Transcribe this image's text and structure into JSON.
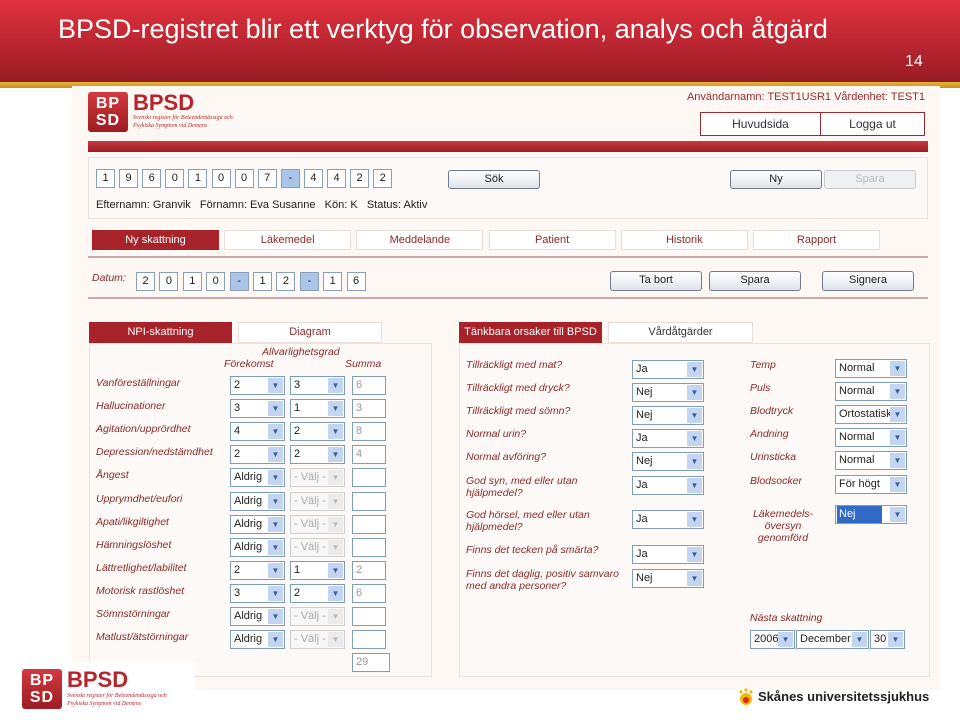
{
  "slide": {
    "title": "BPSD-registret blir ett verktyg för observation, analys och åtgärd",
    "number": "14"
  },
  "app": {
    "logo": {
      "box": "BP SD",
      "word": "BPSD",
      "subtitle1": "Svenskt register för Beteendemässiga och",
      "subtitle2": "Psykiska Symptom vid Demens"
    },
    "user_info": "Användarnamn: TEST1USR1 Vårdenhet: TEST1",
    "nav": {
      "home": "Huvudsida",
      "logout": "Logga ut"
    },
    "search": {
      "digits": [
        "1",
        "9",
        "6",
        "0",
        "1",
        "0",
        "0",
        "7",
        "-",
        "4",
        "4",
        "2",
        "2"
      ],
      "search_label": "Sök",
      "new_label": "Ny",
      "save_label": "Spara"
    },
    "patient": {
      "text": "Efternamn: Granvik   Förnamn: Eva Susanne   Kön: K   Status: Aktiv"
    },
    "tabs": [
      "Ny skattning",
      "Läkemedel",
      "Meddelande",
      "Patient",
      "Historik",
      "Rapport"
    ],
    "date": {
      "label": "Datum:",
      "digits": [
        "2",
        "0",
        "1",
        "0",
        "-",
        "1",
        "2",
        "-",
        "1",
        "6"
      ],
      "delete_label": "Ta bort",
      "save_label": "Spara",
      "sign_label": "Signera"
    },
    "npi": {
      "tabs": [
        "NPI-skattning",
        "Diagram"
      ],
      "headers": {
        "severity": "Allvarlighetsgrad",
        "frequency": "Förekomst",
        "sum": "Summa"
      },
      "rows": [
        {
          "label": "Vanföreställningar",
          "freq": "2",
          "sev": "3",
          "sum": "6"
        },
        {
          "label": "Hallucinationer",
          "freq": "3",
          "sev": "1",
          "sum": "3"
        },
        {
          "label": "Agitation/upprördhet",
          "freq": "4",
          "sev": "2",
          "sum": "8"
        },
        {
          "label": "Depression/nedstämdhet",
          "freq": "2",
          "sev": "2",
          "sum": "4"
        },
        {
          "label": "Ångest",
          "freq": "Aldrig",
          "sev": "- Välj -",
          "sum": ""
        },
        {
          "label": "Upprymdhet/eufori",
          "freq": "Aldrig",
          "sev": "- Välj -",
          "sum": ""
        },
        {
          "label": "Apati/likgiltighet",
          "freq": "Aldrig",
          "sev": "- Välj -",
          "sum": ""
        },
        {
          "label": "Hämningslöshet",
          "freq": "Aldrig",
          "sev": "- Välj -",
          "sum": ""
        },
        {
          "label": "Lättretlighet/labilitet",
          "freq": "2",
          "sev": "1",
          "sum": "2"
        },
        {
          "label": "Motorisk rastlöshet",
          "freq": "3",
          "sev": "2",
          "sum": "6"
        },
        {
          "label": "Sömnstörningar",
          "freq": "Aldrig",
          "sev": "- Välj -",
          "sum": ""
        },
        {
          "label": "Matlust/ätstörningar",
          "freq": "Aldrig",
          "sev": "- Välj -",
          "sum": ""
        }
      ],
      "total": "29"
    },
    "causes": {
      "tabs": [
        "Tänkbara orsaker till BPSD",
        "Vårdåtgärder"
      ],
      "questions": [
        {
          "label": "Tillräckligt med mat?",
          "value": "Ja"
        },
        {
          "label": "Tillräckligt med dryck?",
          "value": "Nej"
        },
        {
          "label": "Tillräckligt med sömn?",
          "value": "Nej"
        },
        {
          "label": "Normal urin?",
          "value": "Ja"
        },
        {
          "label": "Normal avföring?",
          "value": "Nej"
        },
        {
          "label": "God syn, med eller utan\nhjälpmedel?",
          "value": "Ja"
        },
        {
          "label": "God hörsel, med eller utan\nhjälpmedel?",
          "value": "Ja"
        },
        {
          "label": "Finns det tecken på smärta?",
          "value": "Ja"
        },
        {
          "label": "Finns det daglig, positiv samvaro\nmed andra personer?",
          "value": "Nej"
        }
      ],
      "vitals": [
        {
          "label": "Temp",
          "value": "Normal"
        },
        {
          "label": "Puls",
          "value": "Normal"
        },
        {
          "label": "Blodtryck",
          "value": "Ortostatisk"
        },
        {
          "label": "Andning",
          "value": "Normal"
        },
        {
          "label": "Urinsticka",
          "value": "Normal"
        },
        {
          "label": "Blodsocker",
          "value": "För högt"
        },
        {
          "label": "Läkemedels-\növersyn\ngenomförd",
          "value": "Nej"
        }
      ],
      "next": {
        "label": "Nästa skattning",
        "year": "2006",
        "month": "December",
        "day": "30"
      }
    }
  },
  "footer": {
    "hospital": "Skånes universitetssjukhus"
  },
  "colors": {
    "brand_red": "#a8222a",
    "label_maroon": "#8b2a2a",
    "select_arrow": "#c3d5f0"
  }
}
